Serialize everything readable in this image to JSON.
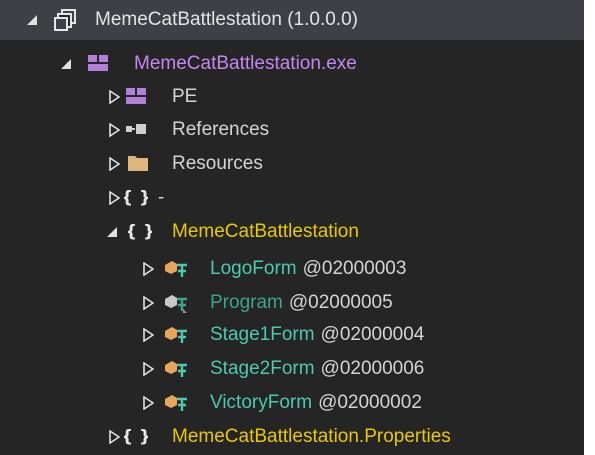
{
  "tree": {
    "root": {
      "name": "MemeCatBattlestation",
      "version": "(1.0.0.0)"
    },
    "module": {
      "name": "MemeCatBattlestation.exe"
    },
    "pe": {
      "label": "PE"
    },
    "references": {
      "label": "References"
    },
    "resources": {
      "label": "Resources"
    },
    "ns_empty": {
      "label": "-"
    },
    "ns_main": {
      "label": "MemeCatBattlestation"
    },
    "types": [
      {
        "name": "LogoForm",
        "token": "@02000003"
      },
      {
        "name": "Program",
        "token": "@02000005"
      },
      {
        "name": "Stage1Form",
        "token": "@02000004"
      },
      {
        "name": "Stage2Form",
        "token": "@02000006"
      },
      {
        "name": "VictoryForm",
        "token": "@02000002"
      }
    ],
    "ns_properties": {
      "label": "MemeCatBattlestation.Properties"
    }
  },
  "colors": {
    "panel_bg": "#252526",
    "selection_bg": "#3f3f46",
    "assembly_text": "#e4e4e4",
    "module_text": "#c586f0",
    "namespace_text": "#e8c900",
    "type_text": "#4ec9b0"
  }
}
